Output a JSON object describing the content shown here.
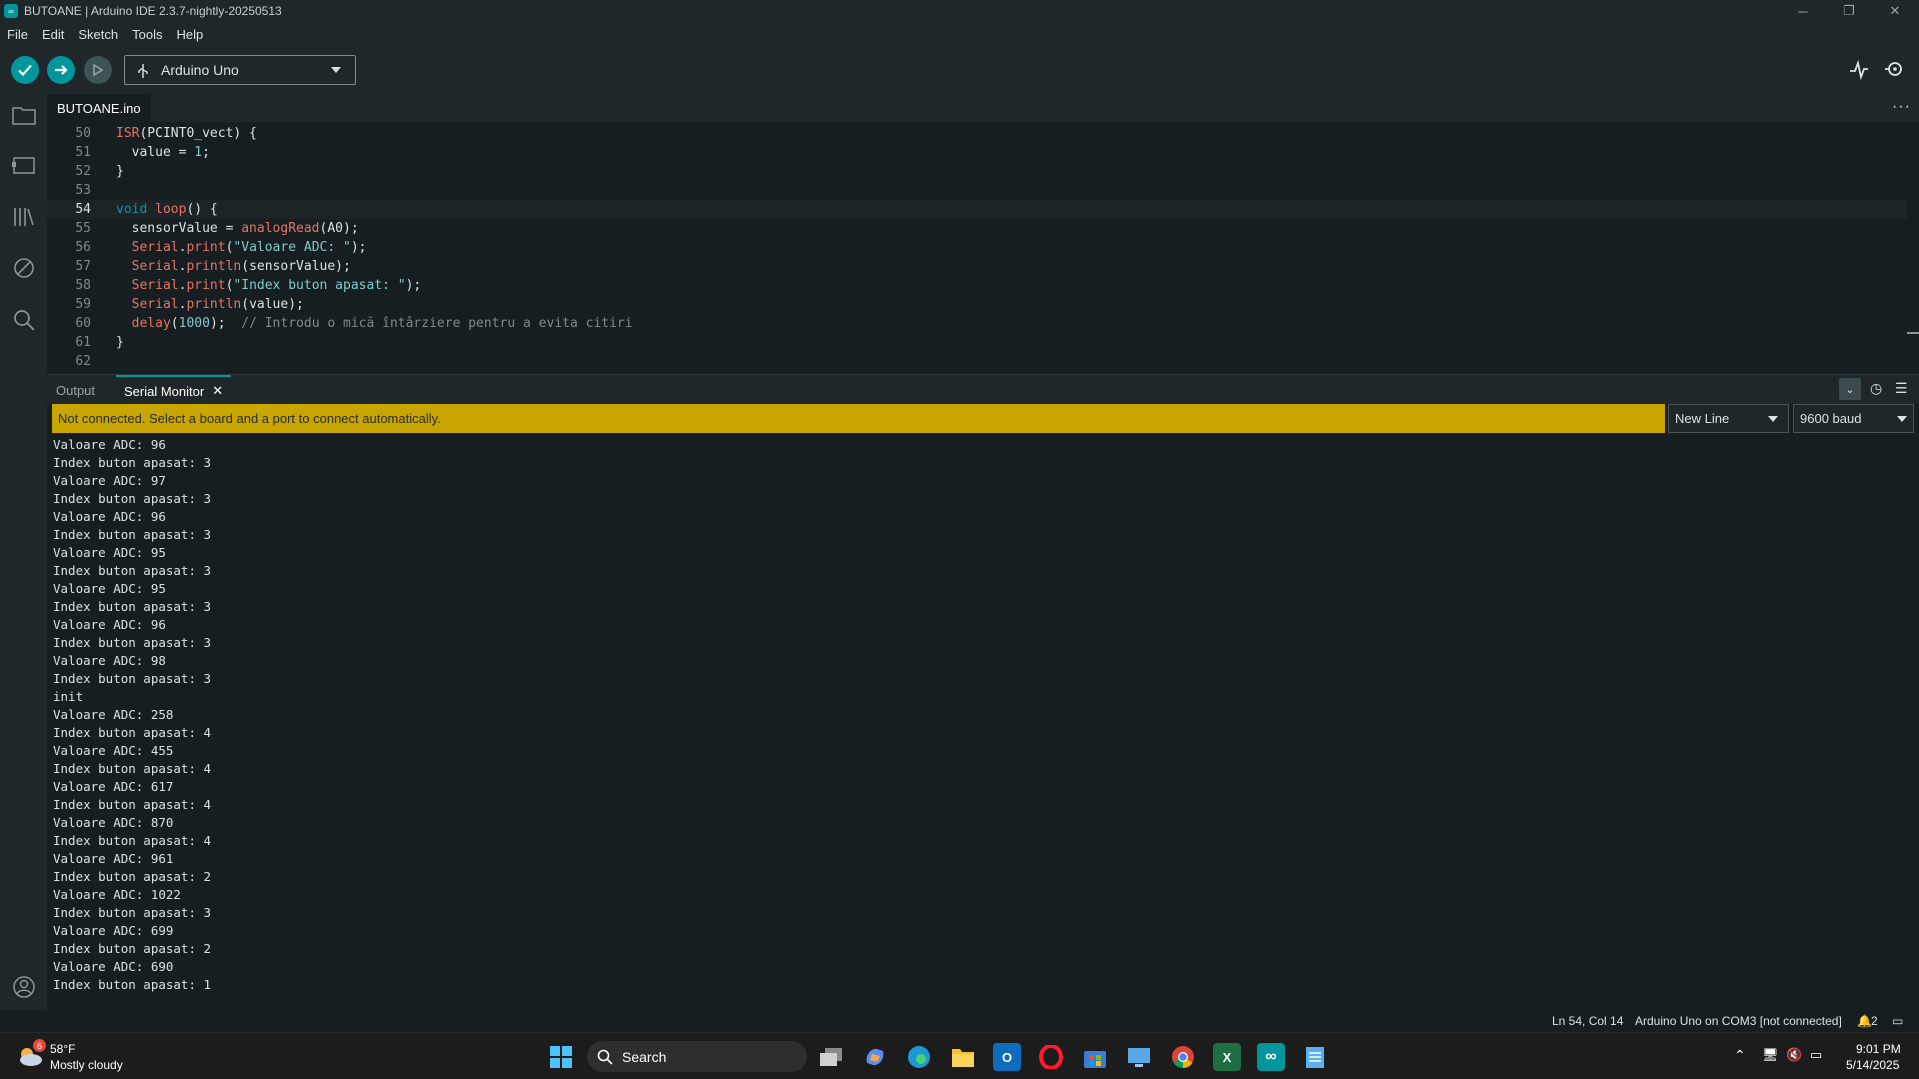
{
  "window": {
    "title": "BUTOANE | Arduino IDE 2.3.7-nightly-20250513"
  },
  "menu": [
    "File",
    "Edit",
    "Sketch",
    "Tools",
    "Help"
  ],
  "toolbar": {
    "board": "Arduino Uno"
  },
  "editor": {
    "tab": "BUTOANE.ino",
    "active_line": "54",
    "lines": [
      {
        "n": "50",
        "t": "ISR(PCINT0_vect) {"
      },
      {
        "n": "51",
        "t": "  value = 1;"
      },
      {
        "n": "52",
        "t": "}"
      },
      {
        "n": "53",
        "t": ""
      },
      {
        "n": "54",
        "t": "void loop() {"
      },
      {
        "n": "55",
        "t": "  sensorValue = analogRead(A0);"
      },
      {
        "n": "56",
        "t": "  Serial.print(\"Valoare ADC: \");"
      },
      {
        "n": "57",
        "t": "  Serial.println(sensorValue);"
      },
      {
        "n": "58",
        "t": "  Serial.print(\"Index buton apasat: \");"
      },
      {
        "n": "59",
        "t": "  Serial.println(value);"
      },
      {
        "n": "60",
        "t": "  delay(1000);  // Introdu o mică întârziere pentru a evita citiri"
      },
      {
        "n": "61",
        "t": "}"
      },
      {
        "n": "62",
        "t": ""
      }
    ]
  },
  "panel": {
    "tab_output": "Output",
    "tab_serial": "Serial Monitor",
    "warning": "Not connected. Select a board and a port to connect automatically.",
    "line_ending": "New Line",
    "baud": "9600 baud",
    "serial_lines": [
      "Valoare ADC: 96",
      "Index buton apasat: 3",
      "Valoare ADC: 97",
      "Index buton apasat: 3",
      "Valoare ADC: 96",
      "Index buton apasat: 3",
      "Valoare ADC: 95",
      "Index buton apasat: 3",
      "Valoare ADC: 95",
      "Index buton apasat: 3",
      "Valoare ADC: 96",
      "Index buton apasat: 3",
      "Valoare ADC: 98",
      "Index buton apasat: 3",
      "init",
      "Valoare ADC: 258",
      "Index buton apasat: 4",
      "Valoare ADC: 455",
      "Index buton apasat: 4",
      "Valoare ADC: 617",
      "Index buton apasat: 4",
      "Valoare ADC: 870",
      "Index buton apasat: 4",
      "Valoare ADC: 961",
      "Index buton apasat: 2",
      "Valoare ADC: 1022",
      "Index buton apasat: 3",
      "Valoare ADC: 699",
      "Index buton apasat: 2",
      "Valoare ADC: 690",
      "Index buton apasat: 1"
    ]
  },
  "status": {
    "position": "Ln 54, Col 14",
    "board_port": "Arduino Uno on COM3 [not connected]",
    "notifications": "2"
  },
  "taskbar": {
    "weather_badge": "6",
    "temperature": "58°F",
    "weather": "Mostly cloudy",
    "search": "Search",
    "time": "9:01 PM",
    "date": "5/14/2025"
  }
}
